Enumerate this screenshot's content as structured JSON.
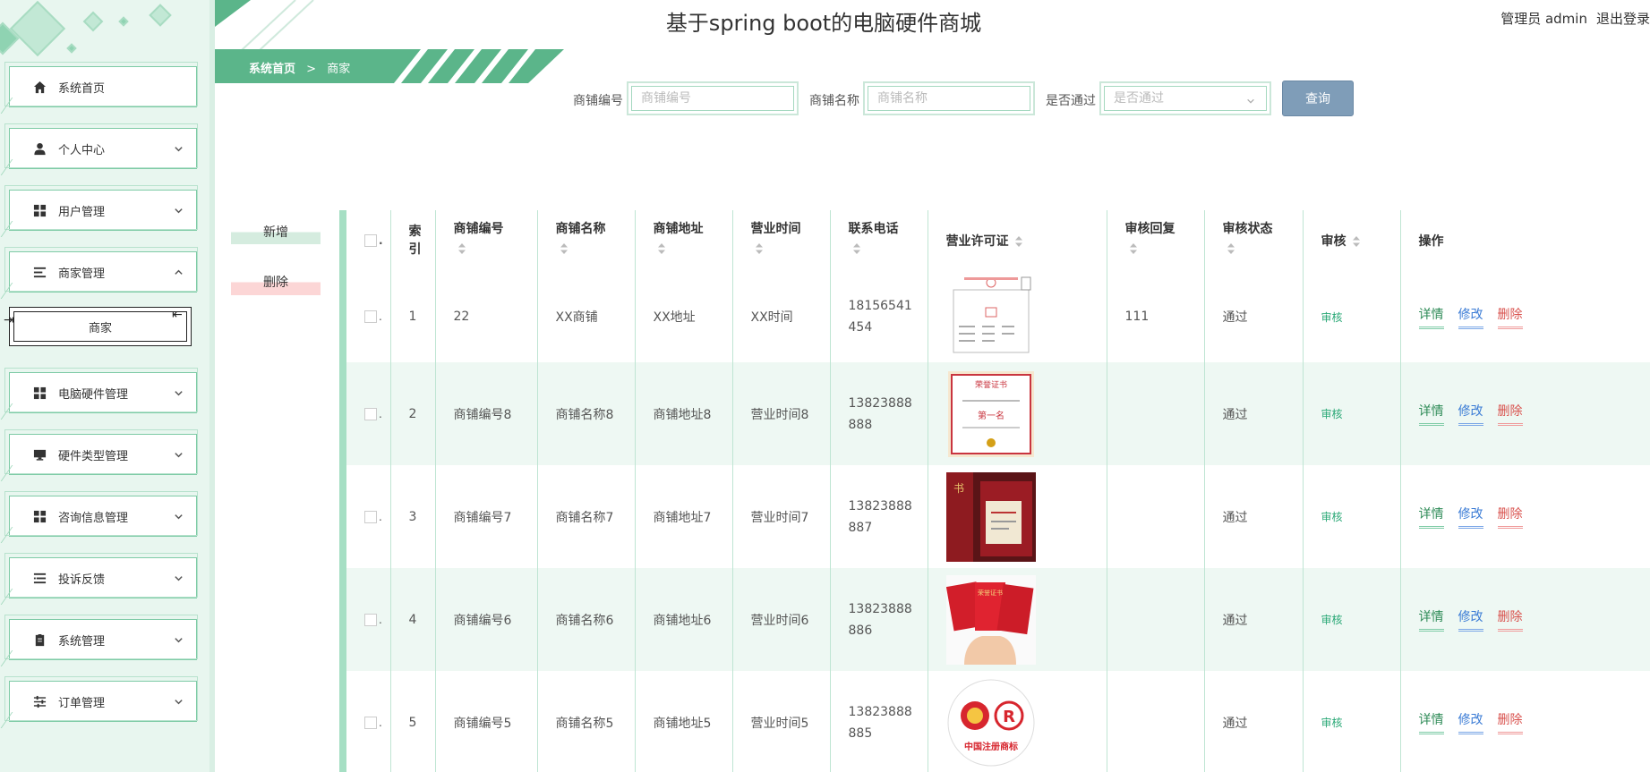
{
  "header": {
    "title": "基于spring boot的电脑硬件商城",
    "user_role": "管理员 admin",
    "logout": "退出登录"
  },
  "sidebar": {
    "items": [
      {
        "label": "系统首页",
        "icon": "home-icon"
      },
      {
        "label": "个人中心",
        "icon": "user-icon"
      },
      {
        "label": "用户管理",
        "icon": "grid-icon"
      },
      {
        "label": "商家管理",
        "icon": "list-icon"
      },
      {
        "label": "电脑硬件管理",
        "icon": "grid-icon"
      },
      {
        "label": "硬件类型管理",
        "icon": "monitor-icon"
      },
      {
        "label": "咨询信息管理",
        "icon": "grid-icon"
      },
      {
        "label": "投诉反馈",
        "icon": "list-indent-icon"
      },
      {
        "label": "系统管理",
        "icon": "clipboard-icon"
      },
      {
        "label": "订单管理",
        "icon": "sliders-icon"
      }
    ],
    "submenu_active": "商家"
  },
  "breadcrumb": {
    "home": "系统首页",
    "separator": ">",
    "current": "商家"
  },
  "search": {
    "shop_no_label": "商铺编号",
    "shop_no_placeholder": "商铺编号",
    "shop_name_label": "商铺名称",
    "shop_name_placeholder": "商铺名称",
    "passed_label": "是否通过",
    "passed_placeholder": "是否通过",
    "query_button": "查询"
  },
  "actions": {
    "add": "新增",
    "delete": "删除"
  },
  "table": {
    "columns": {
      "index": "索引",
      "shop_no": "商铺编号",
      "shop_name": "商铺名称",
      "shop_address": "商铺地址",
      "business_hours": "营业时间",
      "phone": "联系电话",
      "license": "营业许可证",
      "audit_reply": "审核回复",
      "audit_status": "审核状态",
      "audit": "审核",
      "operations": "操作"
    },
    "rows": [
      {
        "index": "1",
        "shop_no": "22",
        "shop_name": "XX商铺",
        "address": "XX地址",
        "hours": "XX时间",
        "phone_a": "18156541",
        "phone_b": "454",
        "license_icon": "certificate-document-image",
        "reply": "111",
        "status": "通过",
        "audit": "审核"
      },
      {
        "index": "2",
        "shop_no": "商铺编号8",
        "shop_name": "商铺名称8",
        "address": "商铺地址8",
        "hours": "营业时间8",
        "phone_a": "13823888",
        "phone_b": "888",
        "license_icon": "honor-certificate-image",
        "reply": "",
        "status": "通过",
        "audit": "审核"
      },
      {
        "index": "3",
        "shop_no": "商铺编号7",
        "shop_name": "商铺名称7",
        "address": "商铺地址7",
        "hours": "营业时间7",
        "phone_a": "13823888",
        "phone_b": "887",
        "license_icon": "red-award-book-image",
        "reply": "",
        "status": "通过",
        "audit": "审核"
      },
      {
        "index": "4",
        "shop_no": "商铺编号6",
        "shop_name": "商铺名称6",
        "address": "商铺地址6",
        "hours": "营业时间6",
        "phone_a": "13823888",
        "phone_b": "886",
        "license_icon": "red-booklets-in-hand-image",
        "reply": "",
        "status": "通过",
        "audit": "审核"
      },
      {
        "index": "5",
        "shop_no": "商铺编号5",
        "shop_name": "商铺名称5",
        "address": "商铺地址5",
        "hours": "营业时间5",
        "phone_a": "13823888",
        "phone_b": "885",
        "license_icon": "registered-trademark-seal-image",
        "reply": "",
        "status": "通过",
        "audit": "审核"
      }
    ],
    "op_detail": "详情",
    "op_edit": "修改",
    "op_delete": "删除"
  },
  "license_texts": {
    "seal_caption": "中国注册商标",
    "honor_caption": "荣誉证书",
    "honor_badge": "第一名",
    "booklet_word": "荣誉证书",
    "book_word": "书"
  },
  "colors": {
    "accent_green": "#5bb58a",
    "sidebar_bg": "#e8f6ef",
    "query_button": "#7f9db8",
    "row_stripe": "#eef8f3",
    "op_detail": "#2e8b57",
    "op_edit": "#3a7bd5",
    "op_delete": "#d9534f"
  }
}
